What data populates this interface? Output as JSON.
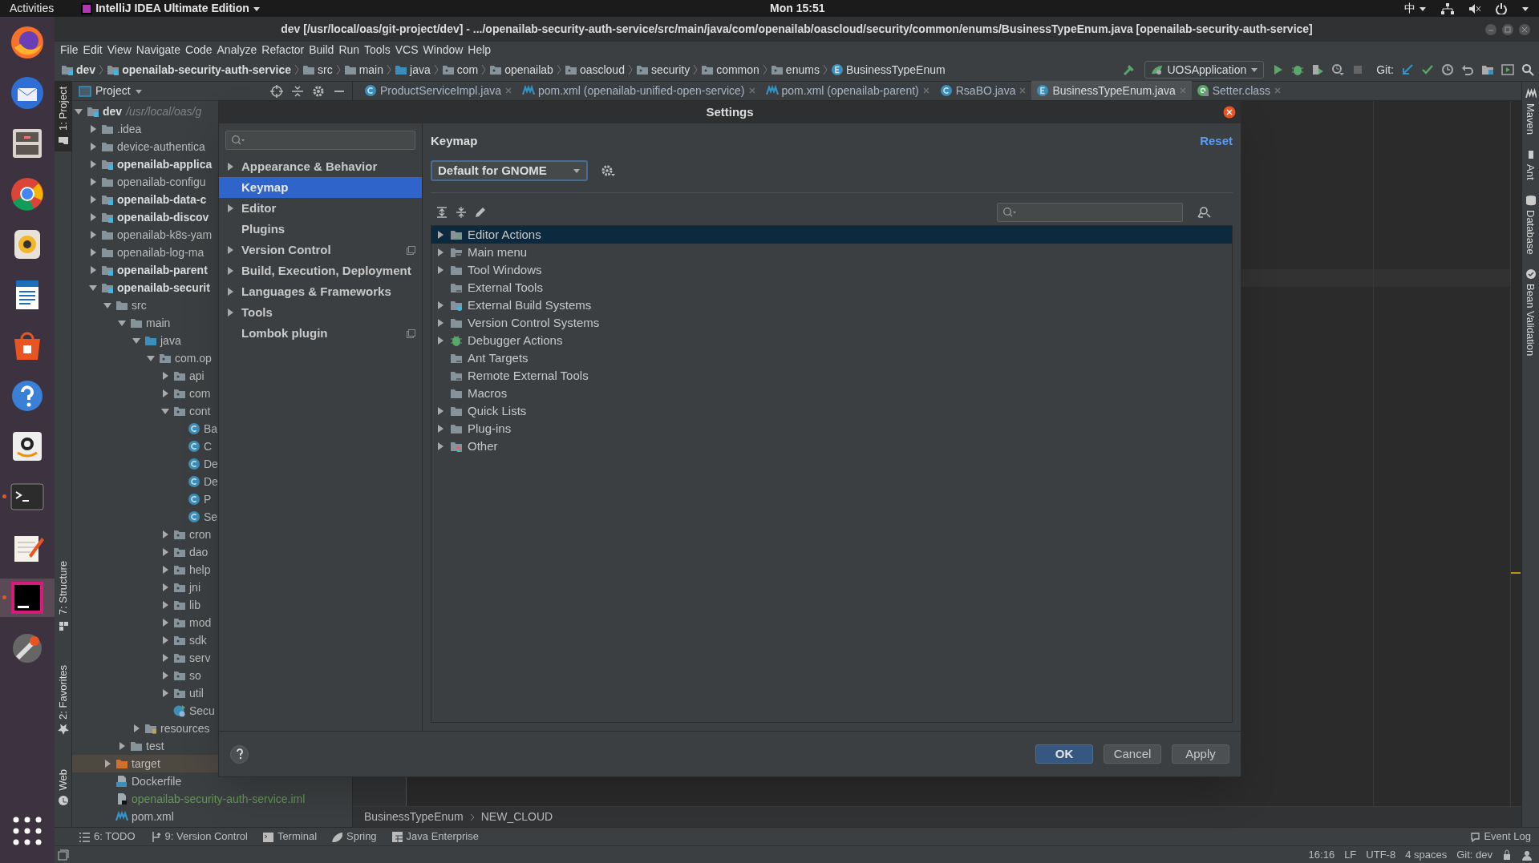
{
  "top_bar": {
    "activities": "Activities",
    "app_menu": "IntelliJ IDEA Ultimate Edition",
    "clock": "Mon 15:51",
    "input_method": "中"
  },
  "dock": [
    {
      "kind": "browser",
      "running": false
    },
    {
      "kind": "mail",
      "running": false
    },
    {
      "kind": "files",
      "running": false
    },
    {
      "kind": "chrome",
      "running": false
    },
    {
      "kind": "speaker",
      "running": false
    },
    {
      "kind": "document",
      "running": false
    },
    {
      "kind": "store",
      "running": false
    },
    {
      "kind": "help",
      "running": false
    },
    {
      "kind": "shop",
      "running": false
    },
    {
      "kind": "terminal",
      "running": true
    },
    {
      "kind": "notepad",
      "running": false
    },
    {
      "kind": "ide",
      "running": true
    },
    {
      "kind": "tools",
      "running": false
    },
    {
      "kind": "grid",
      "running": false
    }
  ],
  "window": {
    "title": "dev [/usr/local/oas/git-project/dev] - .../openailab-security-auth-service/src/main/java/com/openailab/oascloud/security/common/enums/BusinessTypeEnum.java [openailab-security-auth-service]"
  },
  "menu": [
    "File",
    "Edit",
    "View",
    "Navigate",
    "Code",
    "Analyze",
    "Refactor",
    "Build",
    "Run",
    "Tools",
    "VCS",
    "Window",
    "Help"
  ],
  "nav_bar": [
    {
      "label": "dev",
      "kind": "module"
    },
    {
      "label": "openailab-security-auth-service",
      "kind": "module"
    },
    {
      "label": "src",
      "kind": "folder"
    },
    {
      "label": "main",
      "kind": "folder"
    },
    {
      "label": "java",
      "kind": "source"
    },
    {
      "label": "com",
      "kind": "package"
    },
    {
      "label": "openailab",
      "kind": "package"
    },
    {
      "label": "oascloud",
      "kind": "package"
    },
    {
      "label": "security",
      "kind": "package"
    },
    {
      "label": "common",
      "kind": "package"
    },
    {
      "label": "enums",
      "kind": "package"
    },
    {
      "label": "BusinessTypeEnum",
      "kind": "enum"
    }
  ],
  "run_config": "UOSApplication",
  "git_label": "Git:",
  "left_tool_tabs": [
    {
      "label": "1: Project",
      "selected": true
    },
    {
      "label": "7: Structure",
      "selected": false
    },
    {
      "label": "2: Favorites",
      "selected": false
    },
    {
      "label": "Web",
      "selected": false
    }
  ],
  "right_tool_tabs": [
    "Maven",
    "Ant",
    "Database",
    "Bean Validation"
  ],
  "project_panel": {
    "title": "Project",
    "tree": [
      {
        "label": "dev",
        "path": "/usr/local/oas/g",
        "kind": "module",
        "expanded": true,
        "children": [
          {
            "label": ".idea",
            "kind": "folder",
            "expanded": false
          },
          {
            "label": "device-authentica",
            "kind": "folder",
            "expanded": false
          },
          {
            "label": "openailab-applica",
            "kind": "module",
            "expanded": false
          },
          {
            "label": "openailab-configu",
            "kind": "folder",
            "expanded": false
          },
          {
            "label": "openailab-data-c",
            "kind": "module",
            "expanded": false
          },
          {
            "label": "openailab-discov",
            "kind": "module",
            "expanded": false
          },
          {
            "label": "openailab-k8s-yam",
            "kind": "folder",
            "expanded": false
          },
          {
            "label": "openailab-log-ma",
            "kind": "folder",
            "expanded": false
          },
          {
            "label": "openailab-parent",
            "kind": "module",
            "expanded": false
          },
          {
            "label": "openailab-securit",
            "kind": "module",
            "expanded": true,
            "children": [
              {
                "label": "src",
                "kind": "folder",
                "expanded": true,
                "children": [
                  {
                    "label": "main",
                    "kind": "folder",
                    "expanded": true,
                    "children": [
                      {
                        "label": "java",
                        "kind": "source",
                        "expanded": true,
                        "children": [
                          {
                            "label": "com.op",
                            "kind": "package",
                            "expanded": true,
                            "children": [
                              {
                                "label": "api",
                                "kind": "package",
                                "expanded": false
                              },
                              {
                                "label": "com",
                                "kind": "package",
                                "expanded": false
                              },
                              {
                                "label": "cont",
                                "kind": "package",
                                "expanded": true,
                                "children": [
                                  {
                                    "label": "Ba",
                                    "kind": "class"
                                  },
                                  {
                                    "label": "C",
                                    "kind": "class"
                                  },
                                  {
                                    "label": "De",
                                    "kind": "class"
                                  },
                                  {
                                    "label": "De",
                                    "kind": "class"
                                  },
                                  {
                                    "label": "P",
                                    "kind": "class"
                                  },
                                  {
                                    "label": "Se",
                                    "kind": "class"
                                  }
                                ]
                              },
                              {
                                "label": "cron",
                                "kind": "package",
                                "expanded": false
                              },
                              {
                                "label": "dao",
                                "kind": "package",
                                "expanded": false
                              },
                              {
                                "label": "help",
                                "kind": "package",
                                "expanded": false
                              },
                              {
                                "label": "jni",
                                "kind": "package",
                                "expanded": false
                              },
                              {
                                "label": "lib",
                                "kind": "package",
                                "expanded": false
                              },
                              {
                                "label": "mod",
                                "kind": "package",
                                "expanded": false
                              },
                              {
                                "label": "sdk",
                                "kind": "package",
                                "expanded": false
                              },
                              {
                                "label": "serv",
                                "kind": "package",
                                "expanded": false
                              },
                              {
                                "label": "so",
                                "kind": "package",
                                "expanded": false
                              },
                              {
                                "label": "util",
                                "kind": "package",
                                "expanded": false
                              },
                              {
                                "label": "Secu",
                                "kind": "spring-class"
                              }
                            ]
                          }
                        ]
                      },
                      {
                        "label": "resources",
                        "kind": "resources",
                        "expanded": false
                      }
                    ]
                  },
                  {
                    "label": "test",
                    "kind": "folder",
                    "expanded": false
                  }
                ]
              },
              {
                "label": "target",
                "kind": "excluded",
                "expanded": false
              },
              {
                "label": "Dockerfile",
                "kind": "docker"
              },
              {
                "label": "openailab-security-auth-service.iml",
                "kind": "iml"
              },
              {
                "label": "pom.xml",
                "kind": "maven"
              }
            ]
          }
        ]
      }
    ]
  },
  "editor_tabs": [
    {
      "label": "ProductServiceImpl.java",
      "kind": "class",
      "selected": false
    },
    {
      "label": "pom.xml (openailab-unified-open-service)",
      "kind": "maven",
      "selected": false
    },
    {
      "label": "pom.xml (openailab-parent)",
      "kind": "maven",
      "selected": false
    },
    {
      "label": "RsaBO.java",
      "kind": "class",
      "selected": false
    },
    {
      "label": "BusinessTypeEnum.java",
      "kind": "enum",
      "selected": true
    },
    {
      "label": "Setter.class",
      "kind": "annotation",
      "selected": false
    }
  ],
  "editor_breadcrumb": [
    "BusinessTypeEnum",
    "NEW_CLOUD"
  ],
  "bottom_tool_tabs": [
    {
      "label": "6: TODO",
      "kind": "list"
    },
    {
      "label": "9: Version Control",
      "kind": "vcs"
    },
    {
      "label": "Terminal",
      "kind": "terminal"
    },
    {
      "label": "Spring",
      "kind": "leaf"
    },
    {
      "label": "Java Enterprise",
      "kind": "table"
    }
  ],
  "event_log": "Event Log",
  "status_bar": [
    "16:16",
    "LF",
    "UTF-8",
    "4 spaces",
    "Git: dev"
  ],
  "settings": {
    "title": "Settings",
    "nav": [
      {
        "label": "Appearance & Behavior",
        "expanded": false,
        "selected": false,
        "project_scope": false
      },
      {
        "label": "Keymap",
        "selected": true,
        "project_scope": false
      },
      {
        "label": "Editor",
        "expanded": false,
        "selected": false,
        "project_scope": false
      },
      {
        "label": "Plugins",
        "selected": false,
        "project_scope": false
      },
      {
        "label": "Version Control",
        "expanded": false,
        "selected": false,
        "project_scope": true
      },
      {
        "label": "Build, Execution, Deployment",
        "expanded": false,
        "selected": false,
        "project_scope": false
      },
      {
        "label": "Languages & Frameworks",
        "expanded": false,
        "selected": false,
        "project_scope": false
      },
      {
        "label": "Tools",
        "expanded": false,
        "selected": false,
        "project_scope": false
      },
      {
        "label": "Lombok plugin",
        "selected": false,
        "project_scope": true
      }
    ],
    "heading": "Keymap",
    "reset": "Reset",
    "keymap": "Default for GNOME",
    "actions": [
      {
        "label": "Editor Actions",
        "kind": "editor",
        "expanded": false,
        "selected": true
      },
      {
        "label": "Main menu",
        "kind": "menu",
        "expanded": false,
        "selected": false
      },
      {
        "label": "Tool Windows",
        "kind": "folder",
        "expanded": false,
        "selected": false
      },
      {
        "label": "External Tools",
        "kind": "tools",
        "selected": false
      },
      {
        "label": "External Build Systems",
        "kind": "build",
        "expanded": false,
        "selected": false
      },
      {
        "label": "Version Control Systems",
        "kind": "folder",
        "expanded": false,
        "selected": false
      },
      {
        "label": "Debugger Actions",
        "kind": "bug",
        "expanded": false,
        "selected": false
      },
      {
        "label": "Ant Targets",
        "kind": "tools",
        "selected": false
      },
      {
        "label": "Remote External Tools",
        "kind": "tools",
        "selected": false
      },
      {
        "label": "Macros",
        "kind": "folder",
        "selected": false
      },
      {
        "label": "Quick Lists",
        "kind": "folder",
        "expanded": false,
        "selected": false
      },
      {
        "label": "Plug-ins",
        "kind": "folder",
        "expanded": false,
        "selected": false
      },
      {
        "label": "Other",
        "kind": "other",
        "expanded": false,
        "selected": false
      }
    ],
    "buttons": [
      {
        "label": "OK",
        "kind": "default"
      },
      {
        "label": "Cancel",
        "kind": "normal"
      },
      {
        "label": "Apply",
        "kind": "normal"
      }
    ]
  }
}
